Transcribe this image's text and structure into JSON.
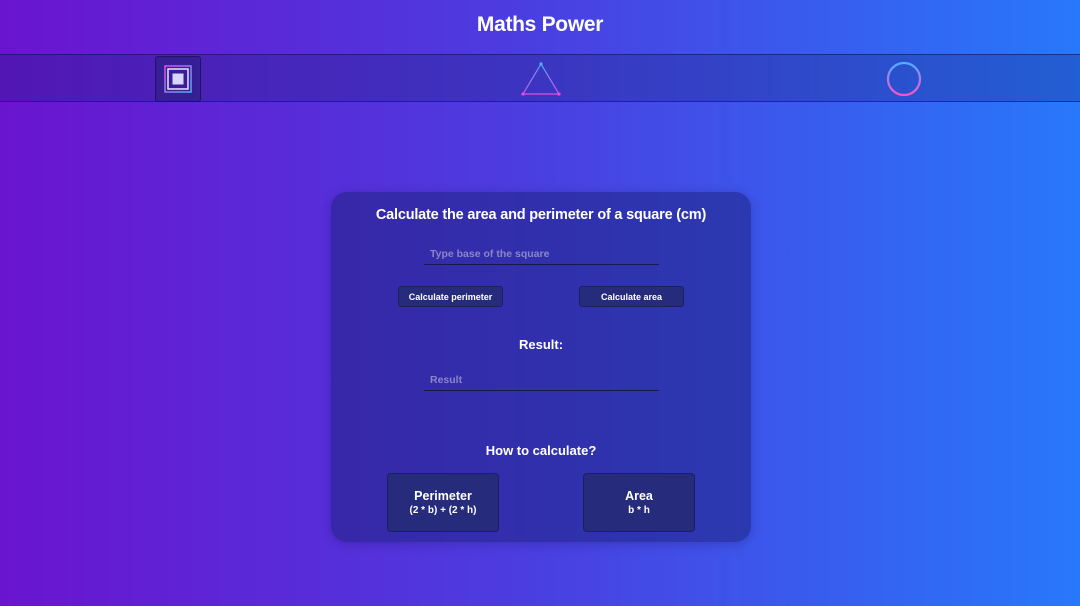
{
  "app": {
    "title": "Maths Power"
  },
  "nav": {
    "items": [
      {
        "icon": "square-icon",
        "active": true
      },
      {
        "icon": "triangle-icon",
        "active": false
      },
      {
        "icon": "circle-icon",
        "active": false
      }
    ]
  },
  "calculator": {
    "title": "Calculate the area and perimeter of a square (cm)",
    "base_input": {
      "placeholder": "Type base of the square",
      "value": ""
    },
    "buttons": {
      "perimeter_label": "Calculate perimeter",
      "area_label": "Calculate area"
    },
    "result_label": "Result:",
    "result_input": {
      "placeholder": "Result",
      "value": ""
    }
  },
  "howto": {
    "title": "How to calculate?",
    "perimeter": {
      "name": "Perimeter",
      "formula": "(2 * b) + (2 * h)"
    },
    "area": {
      "name": "Area",
      "formula": "b * h"
    }
  },
  "colors": {
    "gradient_start": "#6a14cf",
    "gradient_end": "#2878fb",
    "card_bg": "#2a2f8e",
    "button_bg": "#262b7c",
    "icon_accent": "#e04fe0",
    "icon_accent_2": "#4fb0ff"
  }
}
